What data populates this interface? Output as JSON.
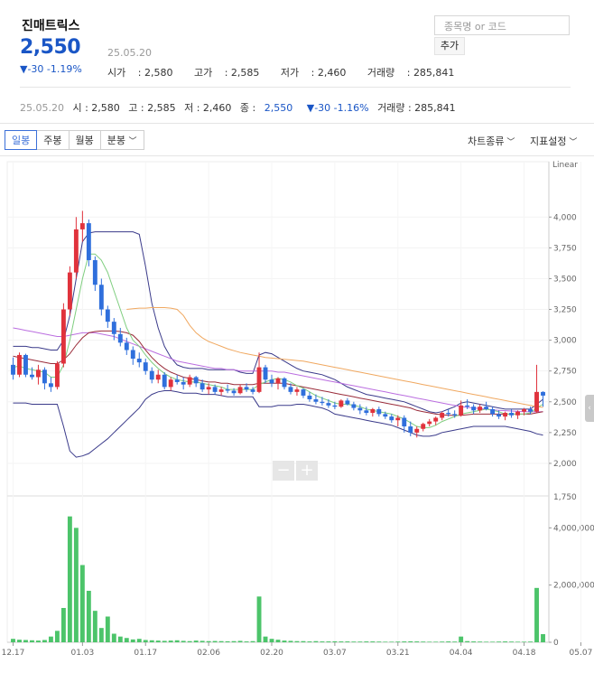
{
  "stock": {
    "name": "진매트릭스",
    "price": "2,550",
    "change": "▼-30 -1.19%",
    "date": "25.05.20",
    "open_label": "시가",
    "open": "2,580",
    "high_label": "고가",
    "high": "2,585",
    "low_label": "저가",
    "low": "2,460",
    "volume_label": "거래량",
    "volume": "285,841"
  },
  "search": {
    "placeholder": "종목명 or 코드",
    "add_label": "추가"
  },
  "daybar": {
    "date": "25.05.20",
    "o": "시 : 2,580",
    "h": "고 : 2,585",
    "l": "저 : 2,460",
    "c_label": "종 : ",
    "c": "2,550",
    "chg": "▼-30 -1.16%",
    "vol": "거래량 : 285,841"
  },
  "toolbar": {
    "tabs": [
      "일봉",
      "주봉",
      "월봉",
      "분봉"
    ],
    "chart_type": "차트종류",
    "indicator": "지표설정"
  },
  "colors": {
    "up": "#e0323c",
    "down": "#2f6fdc",
    "volume": "#4cc46a",
    "ma5": "#7fce7f",
    "ma20": "#9a2c3a",
    "ma60": "#bb6ee0",
    "ma120": "#f0a860",
    "band": "#3a3a8a",
    "accent": "#1a56c6"
  },
  "chart_data": {
    "type": "candlestick",
    "scale_label": "Linear",
    "price_ticks": [
      4000,
      3750,
      3500,
      3250,
      3000,
      2750,
      2500,
      2250,
      2000
    ],
    "price_tick_labels": [
      "4,000",
      "3,750",
      "3,500",
      "3,250",
      "3,000",
      "2,750",
      "2,500",
      "2,250",
      "2,000"
    ],
    "volume_ticks": [
      4000000,
      2000000,
      0
    ],
    "volume_tick_labels": [
      "4,000,000",
      "2,000,000",
      "0"
    ],
    "split_label": "1,750",
    "x_tick_labels": [
      "12.17",
      "01.03",
      "01.17",
      "02.06",
      "02.20",
      "03.07",
      "03.21",
      "04.04",
      "04.18",
      "05.07"
    ],
    "x_tick_index": [
      0,
      11,
      21,
      31,
      41,
      51,
      61,
      71,
      81,
      90
    ],
    "ohlc": [
      [
        2800,
        2860,
        2680,
        2720
      ],
      [
        2720,
        2900,
        2700,
        2880
      ],
      [
        2880,
        2890,
        2700,
        2720
      ],
      [
        2720,
        2780,
        2680,
        2700
      ],
      [
        2700,
        2800,
        2640,
        2760
      ],
      [
        2760,
        2780,
        2600,
        2650
      ],
      [
        2650,
        2700,
        2580,
        2620
      ],
      [
        2620,
        2830,
        2600,
        2810
      ],
      [
        2810,
        3300,
        2780,
        3250
      ],
      [
        3250,
        3600,
        3200,
        3550
      ],
      [
        3550,
        4000,
        3500,
        3900
      ],
      [
        3900,
        4050,
        3800,
        3950
      ],
      [
        3950,
        3980,
        3600,
        3650
      ],
      [
        3650,
        3680,
        3400,
        3450
      ],
      [
        3450,
        3500,
        3200,
        3250
      ],
      [
        3250,
        3280,
        3100,
        3150
      ],
      [
        3150,
        3180,
        3000,
        3050
      ],
      [
        3050,
        3100,
        2950,
        2980
      ],
      [
        2980,
        3020,
        2880,
        2920
      ],
      [
        2920,
        2950,
        2800,
        2850
      ],
      [
        2850,
        2900,
        2780,
        2820
      ],
      [
        2820,
        2850,
        2720,
        2750
      ],
      [
        2750,
        2780,
        2650,
        2680
      ],
      [
        2680,
        2760,
        2650,
        2720
      ],
      [
        2720,
        2740,
        2600,
        2620
      ],
      [
        2620,
        2700,
        2590,
        2680
      ],
      [
        2680,
        2720,
        2640,
        2660
      ],
      [
        2660,
        2700,
        2600,
        2640
      ],
      [
        2640,
        2720,
        2620,
        2700
      ],
      [
        2700,
        2710,
        2620,
        2650
      ],
      [
        2650,
        2680,
        2580,
        2600
      ],
      [
        2600,
        2650,
        2560,
        2620
      ],
      [
        2620,
        2640,
        2560,
        2580
      ],
      [
        2580,
        2620,
        2550,
        2600
      ],
      [
        2600,
        2640,
        2570,
        2590
      ],
      [
        2590,
        2610,
        2550,
        2570
      ],
      [
        2570,
        2640,
        2560,
        2620
      ],
      [
        2620,
        2650,
        2580,
        2600
      ],
      [
        2600,
        2620,
        2560,
        2580
      ],
      [
        2580,
        2900,
        2570,
        2780
      ],
      [
        2780,
        2800,
        2650,
        2680
      ],
      [
        2680,
        2720,
        2620,
        2650
      ],
      [
        2650,
        2700,
        2600,
        2690
      ],
      [
        2690,
        2700,
        2600,
        2620
      ],
      [
        2620,
        2650,
        2560,
        2580
      ],
      [
        2580,
        2620,
        2550,
        2600
      ],
      [
        2600,
        2610,
        2530,
        2550
      ],
      [
        2550,
        2580,
        2500,
        2520
      ],
      [
        2520,
        2560,
        2480,
        2500
      ],
      [
        2500,
        2540,
        2470,
        2490
      ],
      [
        2490,
        2520,
        2450,
        2470
      ],
      [
        2470,
        2500,
        2440,
        2460
      ],
      [
        2460,
        2520,
        2450,
        2510
      ],
      [
        2510,
        2530,
        2470,
        2480
      ],
      [
        2480,
        2500,
        2430,
        2450
      ],
      [
        2450,
        2480,
        2400,
        2430
      ],
      [
        2430,
        2460,
        2390,
        2410
      ],
      [
        2410,
        2450,
        2380,
        2440
      ],
      [
        2440,
        2460,
        2380,
        2400
      ],
      [
        2400,
        2420,
        2360,
        2380
      ],
      [
        2380,
        2400,
        2330,
        2350
      ],
      [
        2350,
        2390,
        2300,
        2370
      ],
      [
        2370,
        2390,
        2250,
        2300
      ],
      [
        2300,
        2340,
        2220,
        2250
      ],
      [
        2250,
        2300,
        2210,
        2280
      ],
      [
        2280,
        2330,
        2260,
        2320
      ],
      [
        2320,
        2360,
        2300,
        2340
      ],
      [
        2340,
        2380,
        2310,
        2370
      ],
      [
        2370,
        2420,
        2350,
        2410
      ],
      [
        2410,
        2440,
        2380,
        2400
      ],
      [
        2400,
        2430,
        2370,
        2390
      ],
      [
        2390,
        2510,
        2380,
        2470
      ],
      [
        2470,
        2520,
        2440,
        2460
      ],
      [
        2460,
        2480,
        2400,
        2430
      ],
      [
        2430,
        2480,
        2410,
        2460
      ],
      [
        2460,
        2500,
        2430,
        2440
      ],
      [
        2440,
        2460,
        2380,
        2400
      ],
      [
        2400,
        2430,
        2360,
        2380
      ],
      [
        2380,
        2420,
        2350,
        2410
      ],
      [
        2410,
        2440,
        2370,
        2390
      ],
      [
        2390,
        2430,
        2360,
        2420
      ],
      [
        2420,
        2450,
        2390,
        2440
      ],
      [
        2440,
        2460,
        2400,
        2420
      ],
      [
        2420,
        2800,
        2410,
        2580
      ],
      [
        2580,
        2585,
        2460,
        2550
      ]
    ],
    "volume": [
      120000,
      90000,
      80000,
      70000,
      60000,
      80000,
      200000,
      400000,
      1200000,
      4400000,
      4000000,
      2700000,
      1800000,
      1100000,
      500000,
      900000,
      300000,
      200000,
      150000,
      100000,
      120000,
      80000,
      70000,
      60000,
      50000,
      60000,
      70000,
      50000,
      40000,
      60000,
      50000,
      40000,
      45000,
      40000,
      35000,
      40000,
      50000,
      30000,
      40000,
      1600000,
      200000,
      120000,
      90000,
      60000,
      50000,
      40000,
      40000,
      30000,
      40000,
      30000,
      30000,
      35000,
      30000,
      30000,
      25000,
      25000,
      30000,
      30000,
      25000,
      20000,
      20000,
      25000,
      30000,
      35000,
      30000,
      25000,
      20000,
      20000,
      25000,
      30000,
      25000,
      200000,
      40000,
      30000,
      25000,
      20000,
      20000,
      25000,
      30000,
      25000,
      20000,
      20000,
      25000,
      1900000,
      285841
    ],
    "ma5": [
      2780,
      2790,
      2770,
      2760,
      2750,
      2740,
      2700,
      2700,
      2800,
      3000,
      3250,
      3500,
      3700,
      3700,
      3650,
      3550,
      3400,
      3250,
      3100,
      3000,
      2950,
      2880,
      2820,
      2770,
      2730,
      2700,
      2680,
      2670,
      2660,
      2660,
      2650,
      2640,
      2630,
      2620,
      2600,
      2600,
      2600,
      2600,
      2600,
      2640,
      2660,
      2680,
      2690,
      2680,
      2660,
      2630,
      2610,
      2580,
      2550,
      2530,
      2510,
      2490,
      2480,
      2480,
      2470,
      2460,
      2440,
      2430,
      2420,
      2410,
      2400,
      2380,
      2360,
      2330,
      2300,
      2290,
      2290,
      2310,
      2340,
      2360,
      2380,
      2400,
      2410,
      2420,
      2430,
      2440,
      2430,
      2420,
      2400,
      2400,
      2400,
      2400,
      2410,
      2450,
      2480
    ],
    "ma20": [
      2870,
      2860,
      2850,
      2840,
      2830,
      2820,
      2810,
      2810,
      2840,
      2890,
      2960,
      3020,
      3060,
      3070,
      3075,
      3075,
      3075,
      3070,
      3060,
      3040,
      2990,
      2920,
      2860,
      2810,
      2770,
      2740,
      2720,
      2700,
      2690,
      2680,
      2670,
      2660,
      2660,
      2650,
      2650,
      2640,
      2640,
      2640,
      2640,
      2650,
      2650,
      2650,
      2650,
      2650,
      2640,
      2630,
      2620,
      2610,
      2600,
      2590,
      2580,
      2570,
      2560,
      2550,
      2540,
      2530,
      2520,
      2510,
      2500,
      2490,
      2480,
      2470,
      2460,
      2450,
      2430,
      2420,
      2410,
      2400,
      2395,
      2390,
      2390,
      2390,
      2395,
      2400,
      2400,
      2400,
      2400,
      2400,
      2400,
      2400,
      2400,
      2400,
      2400,
      2410,
      2420
    ],
    "ma60": [
      3100,
      3090,
      3080,
      3070,
      3060,
      3050,
      3040,
      3030,
      3030,
      3040,
      3050,
      3060,
      3060,
      3060,
      3050,
      3040,
      3030,
      3010,
      2990,
      2970,
      2950,
      2930,
      2910,
      2890,
      2870,
      2850,
      2830,
      2820,
      2810,
      2800,
      2790,
      2780,
      2770,
      2770,
      2760,
      2760,
      2750,
      2750,
      2750,
      2750,
      2750,
      2750,
      2740,
      2740,
      2730,
      2720,
      2710,
      2700,
      2690,
      2680,
      2670,
      2660,
      2650,
      2640,
      2630,
      2620,
      2610,
      2600,
      2590,
      2580,
      2570,
      2560,
      2550,
      2540,
      2530,
      2520,
      2510,
      2500,
      2490,
      2480,
      2470,
      2460,
      2455,
      2450,
      2445,
      2440,
      2435,
      2430,
      2428,
      2425,
      2422,
      2420,
      2418,
      2418,
      2420
    ],
    "ma120": [
      null,
      null,
      null,
      null,
      null,
      null,
      null,
      null,
      null,
      null,
      null,
      null,
      null,
      null,
      null,
      null,
      null,
      null,
      3250,
      3255,
      3260,
      3260,
      3265,
      3265,
      3265,
      3260,
      3250,
      3200,
      3120,
      3060,
      3020,
      2990,
      2970,
      2950,
      2930,
      2915,
      2900,
      2890,
      2880,
      2870,
      2860,
      2855,
      2850,
      2845,
      2840,
      2835,
      2830,
      2820,
      2810,
      2800,
      2790,
      2780,
      2770,
      2760,
      2750,
      2740,
      2730,
      2720,
      2710,
      2700,
      2690,
      2680,
      2670,
      2660,
      2650,
      2640,
      2630,
      2620,
      2610,
      2600,
      2590,
      2580,
      2570,
      2560,
      2550,
      2540,
      2530,
      2520,
      2510,
      2500,
      2490,
      2480,
      2470,
      2460,
      2455
    ],
    "bb_upper": [
      2950,
      2950,
      2950,
      2940,
      2940,
      2930,
      2920,
      2920,
      3000,
      3200,
      3500,
      3800,
      3870,
      3880,
      3880,
      3880,
      3880,
      3880,
      3880,
      3880,
      3860,
      3600,
      3300,
      3100,
      2950,
      2860,
      2800,
      2780,
      2770,
      2770,
      2770,
      2760,
      2760,
      2760,
      2760,
      2760,
      2740,
      2730,
      2730,
      2880,
      2900,
      2890,
      2860,
      2830,
      2800,
      2770,
      2750,
      2740,
      2730,
      2720,
      2700,
      2680,
      2650,
      2620,
      2600,
      2580,
      2560,
      2550,
      2540,
      2530,
      2520,
      2510,
      2500,
      2480,
      2460,
      2440,
      2420,
      2410,
      2420,
      2440,
      2460,
      2490,
      2500,
      2490,
      2480,
      2470,
      2460,
      2450,
      2440,
      2440,
      2440,
      2440,
      2440,
      2480,
      2520
    ],
    "bb_lower": [
      2490,
      2490,
      2490,
      2480,
      2480,
      2480,
      2480,
      2480,
      2300,
      2100,
      2050,
      2060,
      2080,
      2120,
      2160,
      2200,
      2250,
      2300,
      2350,
      2400,
      2450,
      2520,
      2560,
      2580,
      2590,
      2590,
      2580,
      2570,
      2570,
      2570,
      2560,
      2560,
      2560,
      2550,
      2540,
      2540,
      2540,
      2540,
      2540,
      2460,
      2460,
      2460,
      2470,
      2470,
      2470,
      2480,
      2480,
      2470,
      2460,
      2450,
      2430,
      2400,
      2390,
      2380,
      2370,
      2360,
      2350,
      2340,
      2330,
      2320,
      2310,
      2290,
      2270,
      2250,
      2230,
      2220,
      2220,
      2230,
      2250,
      2260,
      2270,
      2280,
      2290,
      2300,
      2300,
      2300,
      2300,
      2300,
      2300,
      2290,
      2280,
      2270,
      2260,
      2240,
      2230
    ]
  }
}
